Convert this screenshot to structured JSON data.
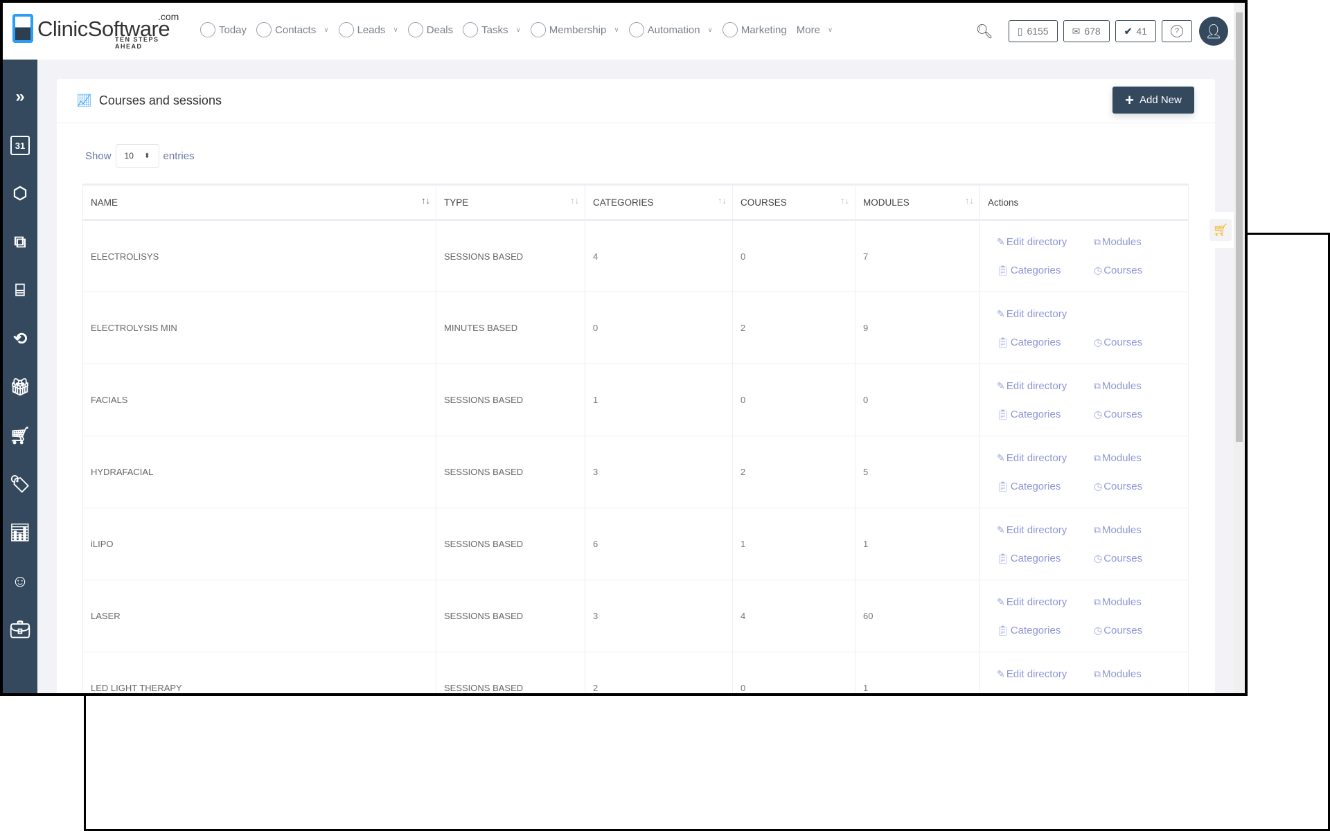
{
  "logo": {
    "word": "ClinicSoftware",
    "com": ".com",
    "tagline": "TEN STEPS AHEAD"
  },
  "nav": [
    {
      "label": "Today",
      "icon": "chart-icon",
      "dropdown": false
    },
    {
      "label": "Contacts",
      "icon": "contacts-icon",
      "dropdown": true
    },
    {
      "label": "Leads",
      "icon": "user-icon",
      "dropdown": true
    },
    {
      "label": "Deals",
      "icon": "gauge-icon",
      "dropdown": false
    },
    {
      "label": "Tasks",
      "icon": "checklist-icon",
      "dropdown": true
    },
    {
      "label": "Membership",
      "icon": "membership-icon",
      "dropdown": true
    },
    {
      "label": "Automation",
      "icon": "hierarchy-icon",
      "dropdown": true
    },
    {
      "label": "Marketing",
      "icon": "chat-icon",
      "dropdown": false
    },
    {
      "label": "More",
      "icon": "",
      "dropdown": true
    }
  ],
  "toolbar": {
    "sms_count": "6155",
    "email_count": "678",
    "tasks_count": "41"
  },
  "page": {
    "title": "Courses and sessions",
    "add_new": "Add New",
    "show": "Show",
    "entries": "entries",
    "page_length": "10"
  },
  "table": {
    "headers": [
      "NAME",
      "TYPE",
      "CATEGORIES",
      "COURSES",
      "MODULES",
      "Actions"
    ],
    "action_labels": {
      "edit": "Edit directory",
      "modules": "Modules",
      "categories": "Categories",
      "courses": "Courses"
    },
    "rows": [
      {
        "name": "ELECTROLISYS",
        "type": "SESSIONS BASED",
        "categories": "4",
        "courses": "0",
        "modules": "7",
        "has_modules": true
      },
      {
        "name": "ELECTROLYSIS MIN",
        "type": "MINUTES BASED",
        "categories": "0",
        "courses": "2",
        "modules": "9",
        "has_modules": false
      },
      {
        "name": "FACIALS",
        "type": "SESSIONS BASED",
        "categories": "1",
        "courses": "0",
        "modules": "0",
        "has_modules": true
      },
      {
        "name": "HYDRAFACIAL",
        "type": "SESSIONS BASED",
        "categories": "3",
        "courses": "2",
        "modules": "5",
        "has_modules": true
      },
      {
        "name": "iLIPO",
        "type": "SESSIONS BASED",
        "categories": "6",
        "courses": "1",
        "modules": "1",
        "has_modules": true
      },
      {
        "name": "LASER",
        "type": "SESSIONS BASED",
        "categories": "3",
        "courses": "4",
        "modules": "60",
        "has_modules": true
      },
      {
        "name": "LED LIGHT THERAPY",
        "type": "SESSIONS BASED",
        "categories": "2",
        "courses": "0",
        "modules": "1",
        "has_modules": true
      }
    ]
  },
  "colors": {
    "sidebar": "#34495e",
    "accent": "#2a9df4",
    "link": "#8e97d8",
    "cart": "#f6b51e"
  }
}
